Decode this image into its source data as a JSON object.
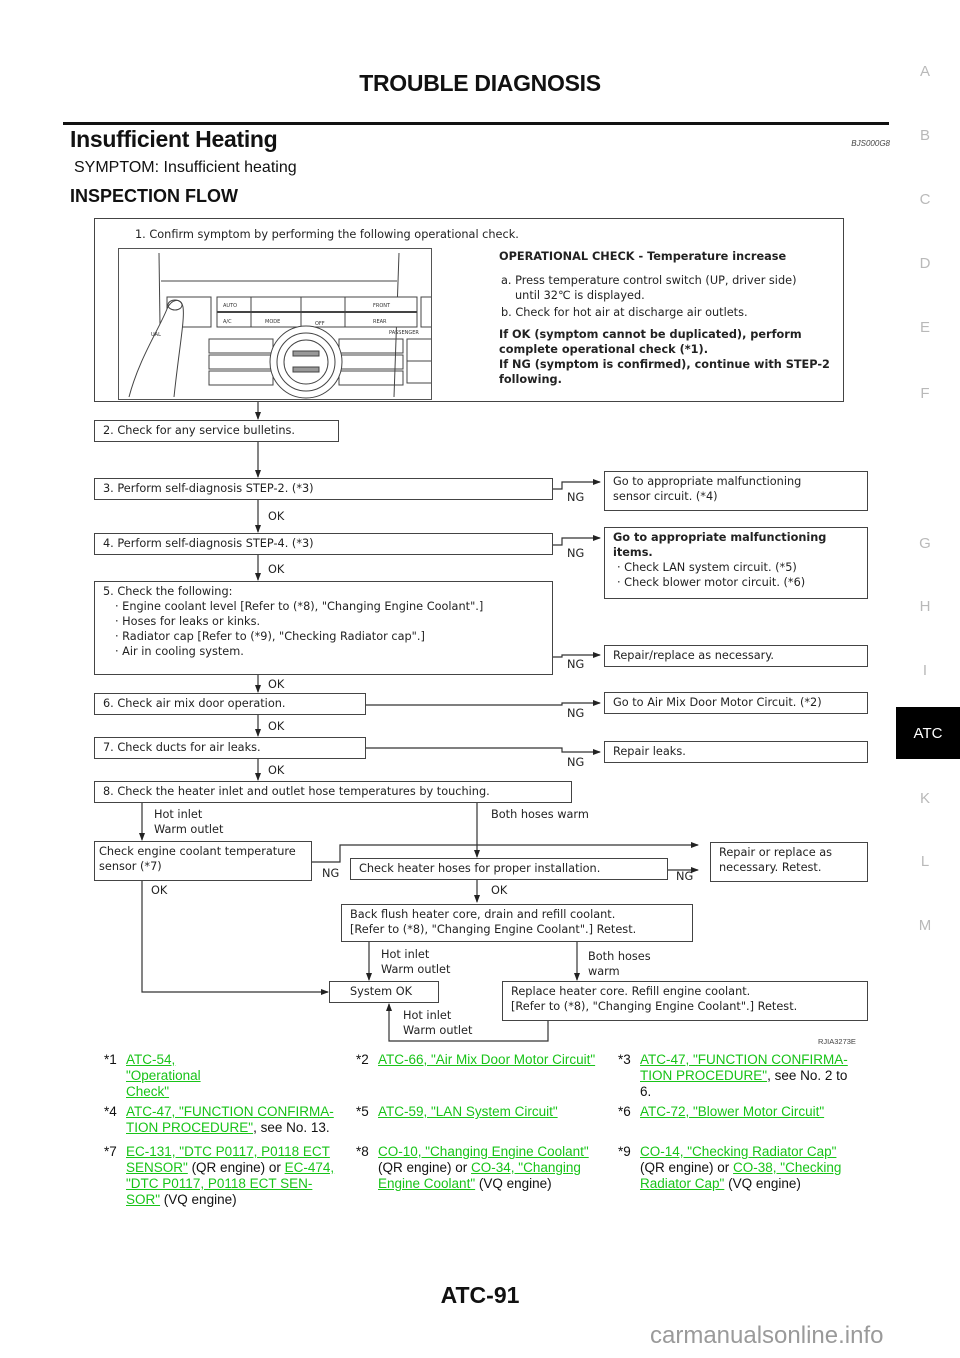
{
  "header": {
    "title": "TROUBLE DIAGNOSIS"
  },
  "section": {
    "title": "Insufficient Heating",
    "ref_code": "BJS000G8",
    "symptom": "SYMPTOM: Insufficient heating",
    "flow_title": "INSPECTION FLOW"
  },
  "side_index": {
    "items": [
      "A",
      "B",
      "C",
      "D",
      "E",
      "F",
      "G",
      "H",
      "I",
      "ATC",
      "K",
      "L",
      "M"
    ],
    "active": "ATC"
  },
  "flow": {
    "step1": {
      "title": "1. Confirm symptom by performing the following operational check.",
      "check_title": "OPERATIONAL CHECK - Temperature increase",
      "a_line1": "a. Press temperature control switch (UP, driver side)",
      "a_line2": "until 32℃  is displayed.",
      "b_line": "b. Check for hot air at discharge air outlets.",
      "ok_line1": "If OK (symptom cannot be duplicated), perform",
      "ok_line2": "complete operational check (*1).",
      "ng_line1": "If NG (symptom is confirmed), continue with STEP-2",
      "ng_line2": "following.",
      "panel": {
        "auto": "AUTO",
        "ac": "A/C",
        "mode": "MODE",
        "off": "OFF",
        "front": "FRONT",
        "rear": "REAR",
        "passenger": "PASSENGER",
        "dual": "UAL"
      }
    },
    "step2": "2. Check for any service bulletins.",
    "step3": "3. Perform self-diagnosis STEP-2. (*3)",
    "step3_ng": "Go to appropriate malfunctioning\nsensor circuit. (*4)",
    "step3_ng_l1": "Go to appropriate malfunctioning",
    "step3_ng_l2": "sensor circuit. (*4)",
    "step4": "4. Perform self-diagnosis STEP-4. (*3)",
    "step4_ng_title_l1": "Go to appropriate malfunctioning",
    "step4_ng_title_l2": "items.",
    "step4_ng_item1": "· Check LAN system circuit. (*5)",
    "step4_ng_item2": "· Check blower motor circuit. (*6)",
    "step5_title": "5.  Check the following:",
    "step5_items": [
      "· Engine coolant level [Refer to (*8), \"Changing Engine Coolant\".]",
      "· Hoses for leaks or kinks.",
      "· Radiator cap [Refer to (*9), \"Checking Radiator cap\".]",
      "· Air in cooling system."
    ],
    "step5_ng": "Repair/replace as necessary.",
    "step6": "6. Check air mix door operation.",
    "step6_ng": "Go to Air Mix Door Motor Circuit. (*2)",
    "step7": "7. Check ducts for air leaks.",
    "step7_ng": "Repair leaks.",
    "step8": "8. Check the heater inlet and outlet hose temperatures by touching.",
    "hot_inlet": "Hot inlet",
    "warm_outlet": "Warm outlet",
    "both_hoses_warm": "Both hoses warm",
    "both_hoses": "Both hoses",
    "warm": "warm",
    "sensor_check_l1": "Check  engine coolant temperature",
    "sensor_check_l2": "sensor (*7)",
    "hoses_install": "Check heater hoses for proper installation.",
    "repair_replace_l1": "Repair or replace as",
    "repair_replace_l2": "necessary. Retest.",
    "back_flush_l1": "Back flush heater core, drain and refill coolant.",
    "back_flush_l2": "[Refer to (*8), \"Changing Engine Coolant\".] Retest.",
    "system_ok": "System OK",
    "replace_core_l1": "Replace heater core. Refill engine coolant.",
    "replace_core_l2": "[Refer to (*8), \"Changing Engine Coolant\".] Retest.",
    "ok": "OK",
    "ng": "NG",
    "figure_code": "RJIA3273E"
  },
  "references": [
    {
      "num": "*1",
      "parts": [
        {
          "link": "ATC-54, \"Operational Check\""
        }
      ]
    },
    {
      "num": "*2",
      "parts": [
        {
          "link": "ATC-66, \"Air Mix Door Motor Circuit\""
        }
      ]
    },
    {
      "num": "*3",
      "line1_link": "ATC-47, \"FUNCTION CONFIRMA-",
      "line2_link": "TION PROCEDURE\"",
      "line2_text": ", see No. 2 to",
      "line3_text": "6."
    },
    {
      "num": "*4",
      "line1_link": "ATC-47, \"FUNCTION CONFIRMA-",
      "line2_link": "TION PROCEDURE\"",
      "line2_text": ", see No. 13."
    },
    {
      "num": "*5",
      "parts": [
        {
          "link": "ATC-59, \"LAN System Circuit\""
        }
      ]
    },
    {
      "num": "*6",
      "parts": [
        {
          "link": "ATC-72, \"Blower Motor Circuit\""
        }
      ]
    },
    {
      "num": "*7",
      "line1_link": "EC-131, \"DTC P0117, P0118 ECT ",
      "line2_link": "SENSOR\"",
      "line2_text": " (QR engine) or ",
      "line2_link2": "EC-474, ",
      "line3_link": "\"DTC P0117, P0118 ECT SEN-",
      "line4_link": "SOR\"",
      "line4_text": "  (VQ engine)"
    },
    {
      "num": "*8",
      "line1_link": "CO-10, \"Changing Engine Coolant\"",
      "line2_text": "(QR engine) or ",
      "line2_link": "CO-34, \"Changing ",
      "line3_link": "Engine Coolant\"",
      "line3_text": "  (VQ engine)"
    },
    {
      "num": "*9",
      "line1_link": "CO-14, \"Checking Radiator Cap\"",
      "line2_text": "(QR engine) or ",
      "line2_link": "CO-38, \"Checking ",
      "line3_link": "Radiator Cap\"",
      "line3_text": "  (VQ engine)"
    }
  ],
  "footer": {
    "page": "ATC-91",
    "watermark": "carmanualsonline.info"
  },
  "colors": {
    "link": "#18c318",
    "tab_active_bg": "#000000",
    "side_letter": "#b9b9b9"
  }
}
